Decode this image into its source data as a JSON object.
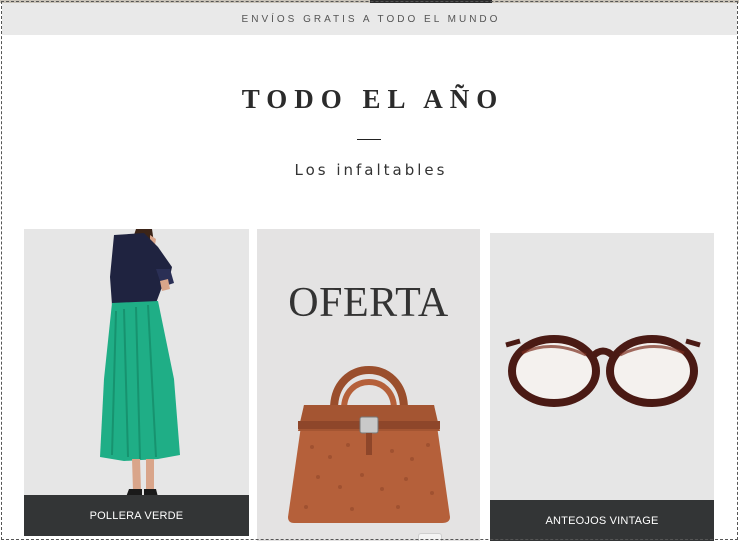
{
  "banner": {
    "text": "ENVÍOS GRATIS A TODO EL MUNDO"
  },
  "section": {
    "title": "TODO EL AÑO",
    "subtitle": "Los infaltables"
  },
  "products": [
    {
      "caption": "POLLERA VERDE",
      "image_icon": "green-skirt-image"
    },
    {
      "overlay": "OFERTA",
      "image_icon": "brown-handbag-image"
    },
    {
      "caption": "ANTEOJOS VINTAGE",
      "image_icon": "tortoiseshell-glasses-image"
    }
  ],
  "colors": {
    "banner_bg": "#e9e9e9",
    "caption_bg": "#333536",
    "card_bg": "#e6e6e6",
    "skirt": "#1fae86",
    "blouse": "#1f2340",
    "bag": "#b5603a",
    "glasses": "#4a1a14"
  }
}
